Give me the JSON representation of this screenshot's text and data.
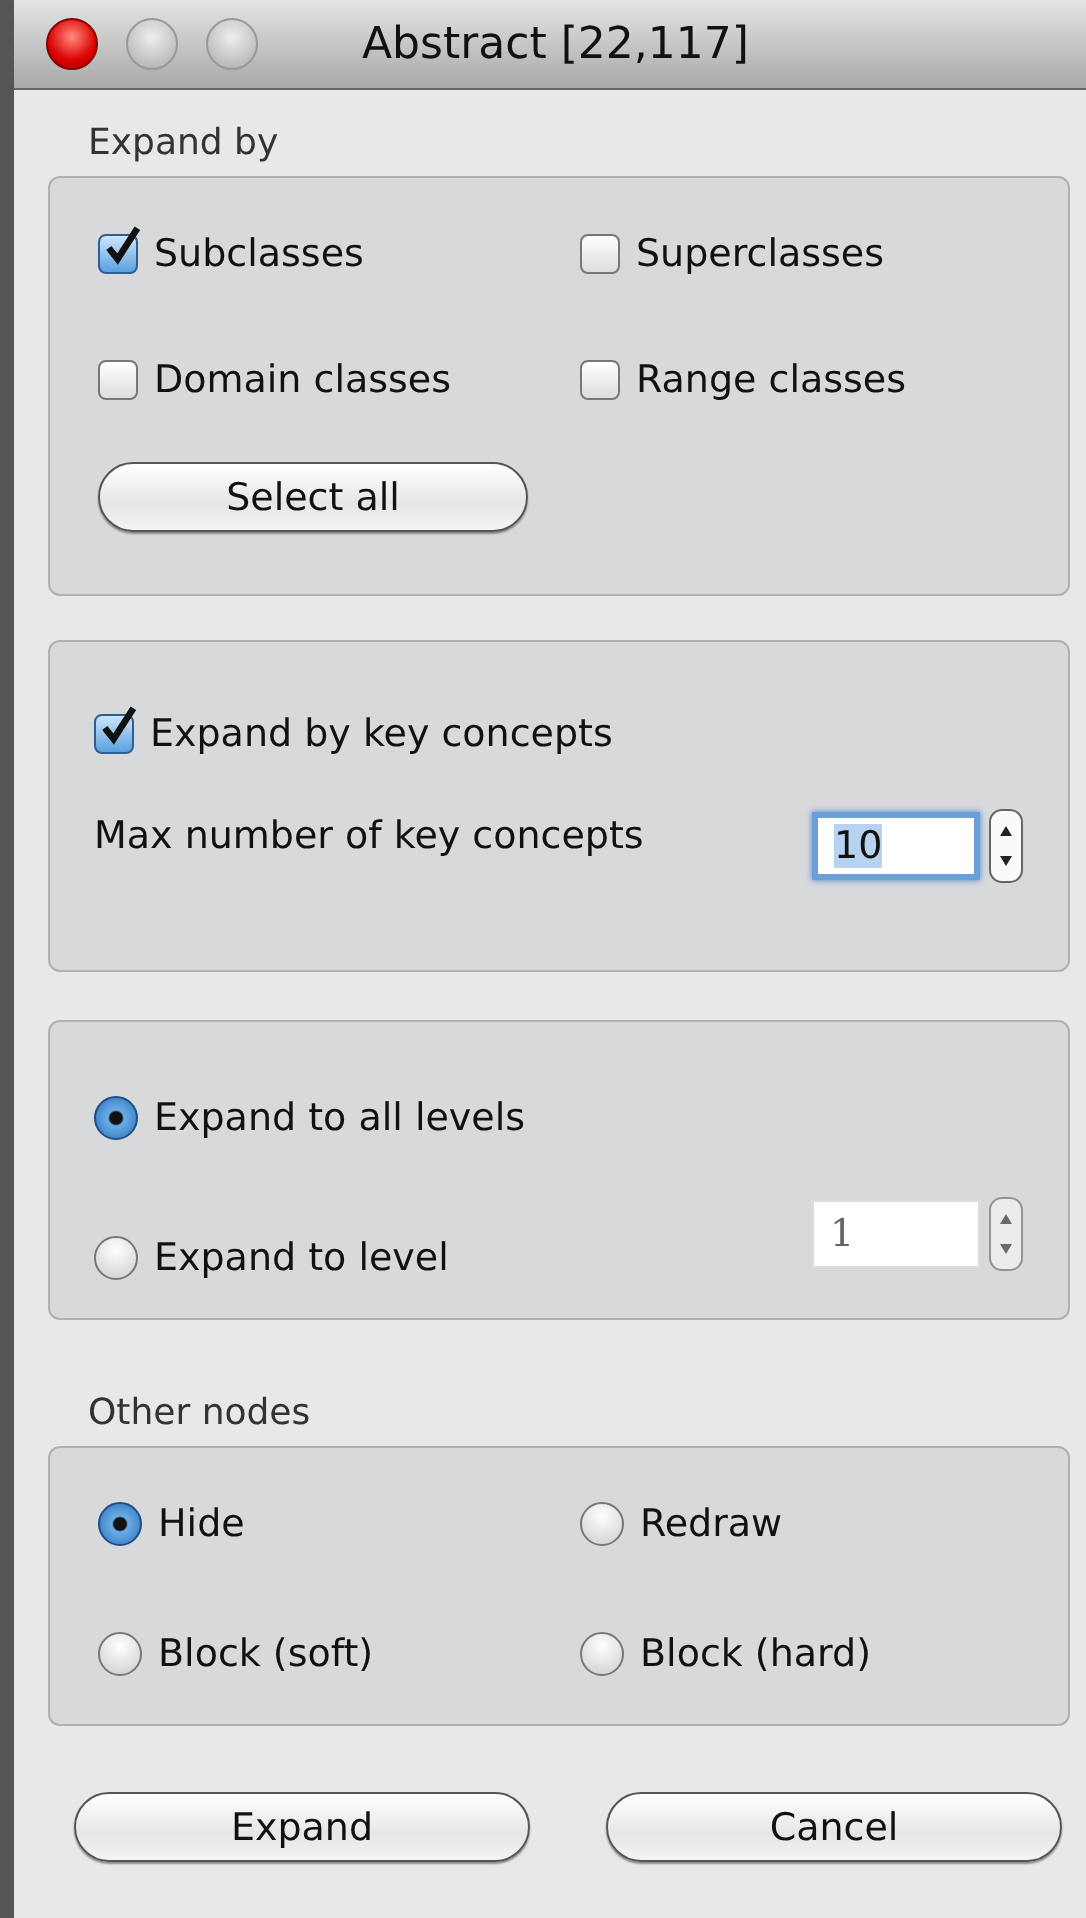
{
  "window": {
    "title": "Abstract [22,117]"
  },
  "expand_by": {
    "label": "Expand by",
    "options": [
      {
        "label": "Subclasses",
        "checked": true
      },
      {
        "label": "Superclasses",
        "checked": false
      },
      {
        "label": "Domain classes",
        "checked": false
      },
      {
        "label": "Range classes",
        "checked": false
      }
    ],
    "select_all_button": "Select all"
  },
  "key_concepts": {
    "checkbox": {
      "label": "Expand by key concepts",
      "checked": true
    },
    "max_label": "Max number of key concepts",
    "max_field": {
      "value": "10",
      "disabled": false
    }
  },
  "levels": {
    "options": [
      {
        "label": "Expand to all levels",
        "selected": true
      },
      {
        "label": "Expand to level",
        "selected": false
      }
    ],
    "level_field": {
      "value": "1",
      "disabled": true
    }
  },
  "other_nodes": {
    "label": "Other nodes",
    "options": [
      {
        "label": "Hide",
        "selected": true
      },
      {
        "label": "Redraw",
        "selected": false
      },
      {
        "label": "Block (soft)",
        "selected": false
      },
      {
        "label": "Block (hard)",
        "selected": false
      }
    ]
  },
  "buttons": [
    "Expand",
    "Cancel"
  ]
}
